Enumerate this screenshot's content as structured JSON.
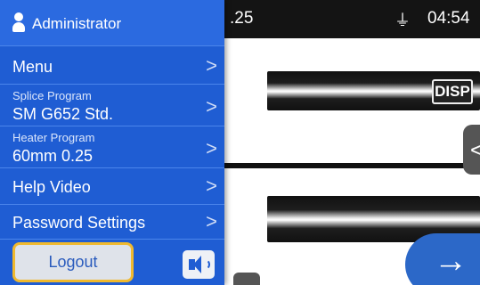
{
  "header": {
    "user_label": "Administrator",
    "program_fragment": ".25",
    "power_icon": "plug-icon",
    "time": "04:54"
  },
  "menu": {
    "items": [
      {
        "label": "Menu"
      },
      {
        "sub": "Splice Program",
        "value": "SM G652 Std."
      },
      {
        "sub": "Heater Program",
        "value": "60mm 0.25"
      },
      {
        "label": "Help Video"
      },
      {
        "label": "Password Settings"
      }
    ],
    "chevron": ">"
  },
  "actions": {
    "logout_label": "Logout",
    "sound_icon": "speaker-icon"
  },
  "view": {
    "disp_label": "DISP",
    "side_tab_glyph": "<",
    "next_glyph": "→"
  },
  "colors": {
    "drawer_bg": "#1f5dd3",
    "focus_outline": "#f0b92e",
    "next_button": "#2c68c8"
  }
}
